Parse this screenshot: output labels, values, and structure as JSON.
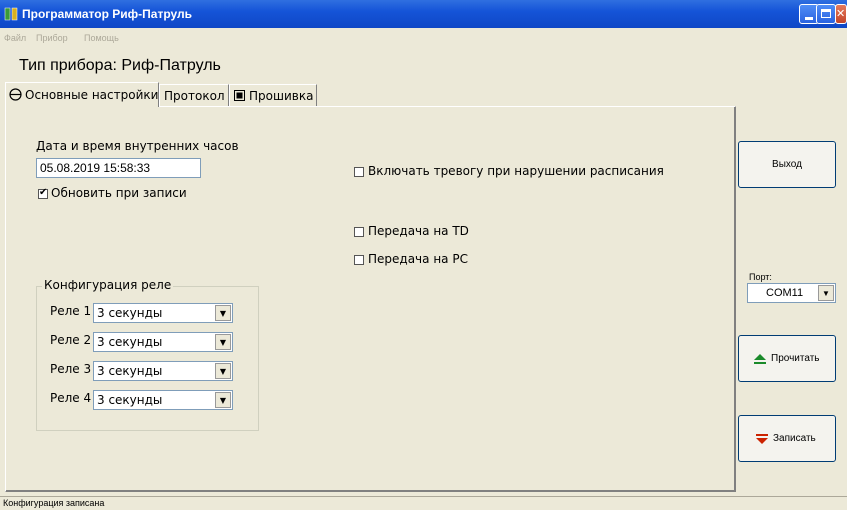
{
  "window": {
    "title": "Программатор Риф-Патруль"
  },
  "menu": {
    "items": [
      "Файл",
      "Прибор",
      "Помощь"
    ]
  },
  "device": {
    "title": "Тип прибора: Риф-Патруль"
  },
  "tabs": [
    {
      "label": "Основные настройки",
      "icon": "circle-minus-icon",
      "active": true
    },
    {
      "label": "Протокол",
      "active": false
    },
    {
      "label": "Прошивка",
      "icon": "square-icon",
      "active": false
    }
  ],
  "clock": {
    "label": "Дата и время внутренних часов",
    "value": "05.08.2019 15:58:33",
    "update_label": "Обновить при записи",
    "update_checked": true
  },
  "options": [
    {
      "label": "Включать тревогу при нарушении расписания",
      "checked": false
    },
    {
      "label": "Передача на TD",
      "checked": false
    },
    {
      "label": "Передача на PC",
      "checked": false
    }
  ],
  "relays": {
    "title": "Конфигурация реле",
    "items": [
      {
        "label": "Реле 1",
        "value": "3 секунды"
      },
      {
        "label": "Реле 2",
        "value": "3 секунды"
      },
      {
        "label": "Реле 3",
        "value": "3 секунды"
      },
      {
        "label": "Реле 4",
        "value": "3 секунды"
      }
    ]
  },
  "buttons": {
    "exit": "Выход",
    "read": "Прочитать",
    "write": "Записать"
  },
  "port": {
    "label": "Порт:",
    "value": "COM11"
  },
  "status": {
    "text": "Конфигурация записана"
  },
  "colors": {
    "titlebar": "#1554d8",
    "read_icon": "#1a8a2a",
    "write_icon": "#cc2200"
  }
}
